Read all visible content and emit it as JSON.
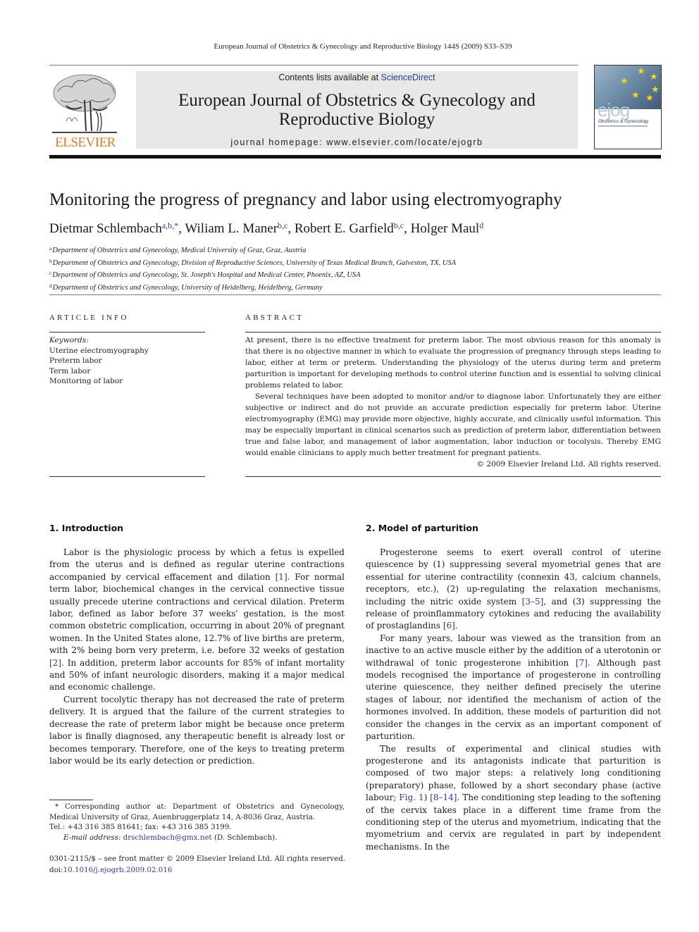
{
  "running_head": "European Journal of Obstetrics & Gynecology and Reproductive Biology 144S (2009) S33–S39",
  "header": {
    "publisher": "ELSEVIER",
    "contents_prefix": "Contents lists available at ",
    "contents_link": "ScienceDirect",
    "journal_title_line1": "European Journal of Obstetrics & Gynecology and",
    "journal_title_line2": "Reproductive Biology",
    "homepage": "journal homepage: www.elsevier.com/locate/ejogrb",
    "cover": {
      "acronym": "ejog",
      "subtitle": "Obstetrics & Gynecology"
    },
    "colors": {
      "publisher_orange": "#e87722",
      "link_blue": "#2a3a9e",
      "header_gray": "#e8e8e8"
    }
  },
  "article": {
    "title": "Monitoring the progress of pregnancy and labor using electromyography",
    "authors": [
      {
        "name": "Dietmar Schlembach",
        "sup": "a,b,*",
        "sep": ", "
      },
      {
        "name": "Wiliam L. Maner",
        "sup": "b,c",
        "sep": ", "
      },
      {
        "name": "Robert E. Garfield",
        "sup": "b,c",
        "sep": ", "
      },
      {
        "name": "Holger Maul",
        "sup": "d",
        "sep": ""
      }
    ],
    "affiliations": [
      {
        "mark": "a",
        "text": "Department of Obstetrics and Gynecology, Medical University of Graz, Graz, Austria"
      },
      {
        "mark": "b",
        "text": "Department of Obstetrics and Gynecology, Division of Reproductive Sciences, University of Texas Medical Branch, Galveston, TX, USA"
      },
      {
        "mark": "c",
        "text": "Department of Obstetrics and Gynecology, St. Joseph's Hospital and Medical Center, Phoenix, AZ, USA"
      },
      {
        "mark": "d",
        "text": "Department of Obstetrics and Gynecology, University of Heidelberg, Heidelberg, Germany"
      }
    ]
  },
  "article_info": {
    "label": "ARTICLE INFO",
    "keywords_label": "Keywords:",
    "keywords": [
      "Uterine electromyography",
      "Preterm labor",
      "Term labor",
      "Monitoring of labor"
    ]
  },
  "abstract": {
    "label": "ABSTRACT",
    "paragraphs": [
      "At present, there is no effective treatment for preterm labor. The most obvious reason for this anomaly is that there is no objective manner in which to evaluate the progression of pregnancy through steps leading to labor, either at term or preterm. Understanding the physiology of the uterus during term and preterm parturition is important for developing methods to control uterine function and is essential to solving clinical problems related to labor.",
      "Several techniques have been adopted to monitor and/or to diagnose labor. Unfortunately they are either subjective or indirect and do not provide an accurate prediction especially for preterm labor. Uterine electromyography (EMG) may provide more objective, highly accurate, and clinically useful information. This may be especially important in clinical scenarios such as prediction of preterm labor, differentiation between true and false labor, and management of labor augmentation, labor induction or tocolysis. Thereby EMG would enable clinicians to apply much better treatment for pregnant patients."
    ],
    "copyright": "© 2009 Elsevier Ireland Ltd. All rights reserved."
  },
  "sections": {
    "intro": {
      "heading": "1.  Introduction",
      "p1": {
        "a": "Labor is the physiologic process by which a fetus is expelled from the uterus and is defined as regular uterine contractions accompanied by cervical effacement and dilation ",
        "ref1": "[1]",
        "b": ". For normal term labor, biochemical changes in the cervical connective tissue usually precede uterine contractions and cervical dilation. Preterm labor, defined as labor before 37 weeks' gestation, is the most common obstetric complication, occurring in about 20% of pregnant women. In the United States alone, 12.7% of live births are preterm, with 2% being born very preterm, i.e. before 32 weeks of gestation ",
        "ref2": "[2]",
        "c": ". In addition, preterm labor accounts for 85% of infant mortality and 50% of infant neurologic disorders, making it a major medical and economic challenge."
      },
      "p2": "Current tocolytic therapy has not decreased the rate of preterm delivery. It is argued that the failure of the current strategies to decrease the rate of preterm labor might be because once preterm labor is finally diagnosed, any therapeutic benefit is already lost or becomes temporary. Therefore, one of the keys to treating preterm labor would be its early detection or prediction."
    },
    "model": {
      "heading": "2.  Model of parturition",
      "p1": {
        "a": "Progesterone seems to exert overall control of uterine quiescence by (1) suppressing several myometrial genes that are essential for uterine contractility (connexin 43, calcium channels, receptors, etc.), (2) up-regulating the relaxation mechanisms, including the nitric oxide system ",
        "ref1": "[3–5]",
        "b": ", and (3) suppressing the release of proinflammatory cytokines and reducing the availability of prostaglandins ",
        "ref2": "[6]",
        "c": "."
      },
      "p2": {
        "a": "For many years, labour was viewed as the transition from an inactive to an active muscle either by the addition of a uterotonin or withdrawal of tonic progesterone inhibition ",
        "ref1": "[7]",
        "b": ". Although past models recognised the importance of progesterone in controlling uterine quiescence, they neither defined precisely the uterine stages of labour, nor identified the mechanism of action of the hormones involved. In addition, these models of parturition did not consider the changes in the cervix as an important component of parturition."
      },
      "p3": {
        "a": "The results of experimental and clinical studies with progesterone and its antagonists indicate that parturition is composed of two major steps: a relatively long conditioning (preparatory) phase, followed by a short secondary phase (active labour; ",
        "ref1": "Fig. 1",
        "b": ") ",
        "ref2": "[8–14]",
        "c": ". The conditioning step leading to the softening of the cervix takes place in a different time frame from the conditioning step of the uterus and myometrium, indicating that the myometrium and cervix are regulated in part by independent mechanisms. In the"
      }
    }
  },
  "footnote": {
    "corresponding": "* Corresponding author at: Department of Obstetrics and Gynecology, Medical University of Graz, Auenbruggerplatz 14, A-8036 Graz, Austria.",
    "tel": "Tel.: +43 316 385 81641; fax: +43 316 385 3199.",
    "email_label": "E-mail address: ",
    "email": "drschlembach@gmx.net",
    "email_suffix": " (D. Schlembach)."
  },
  "front_matter": {
    "issn_line": "0301-2115/$ – see front matter © 2009 Elsevier Ireland Ltd. All rights reserved.",
    "doi_prefix": "doi:",
    "doi": "10.1016/j.ejogrb.2009.02.016"
  }
}
